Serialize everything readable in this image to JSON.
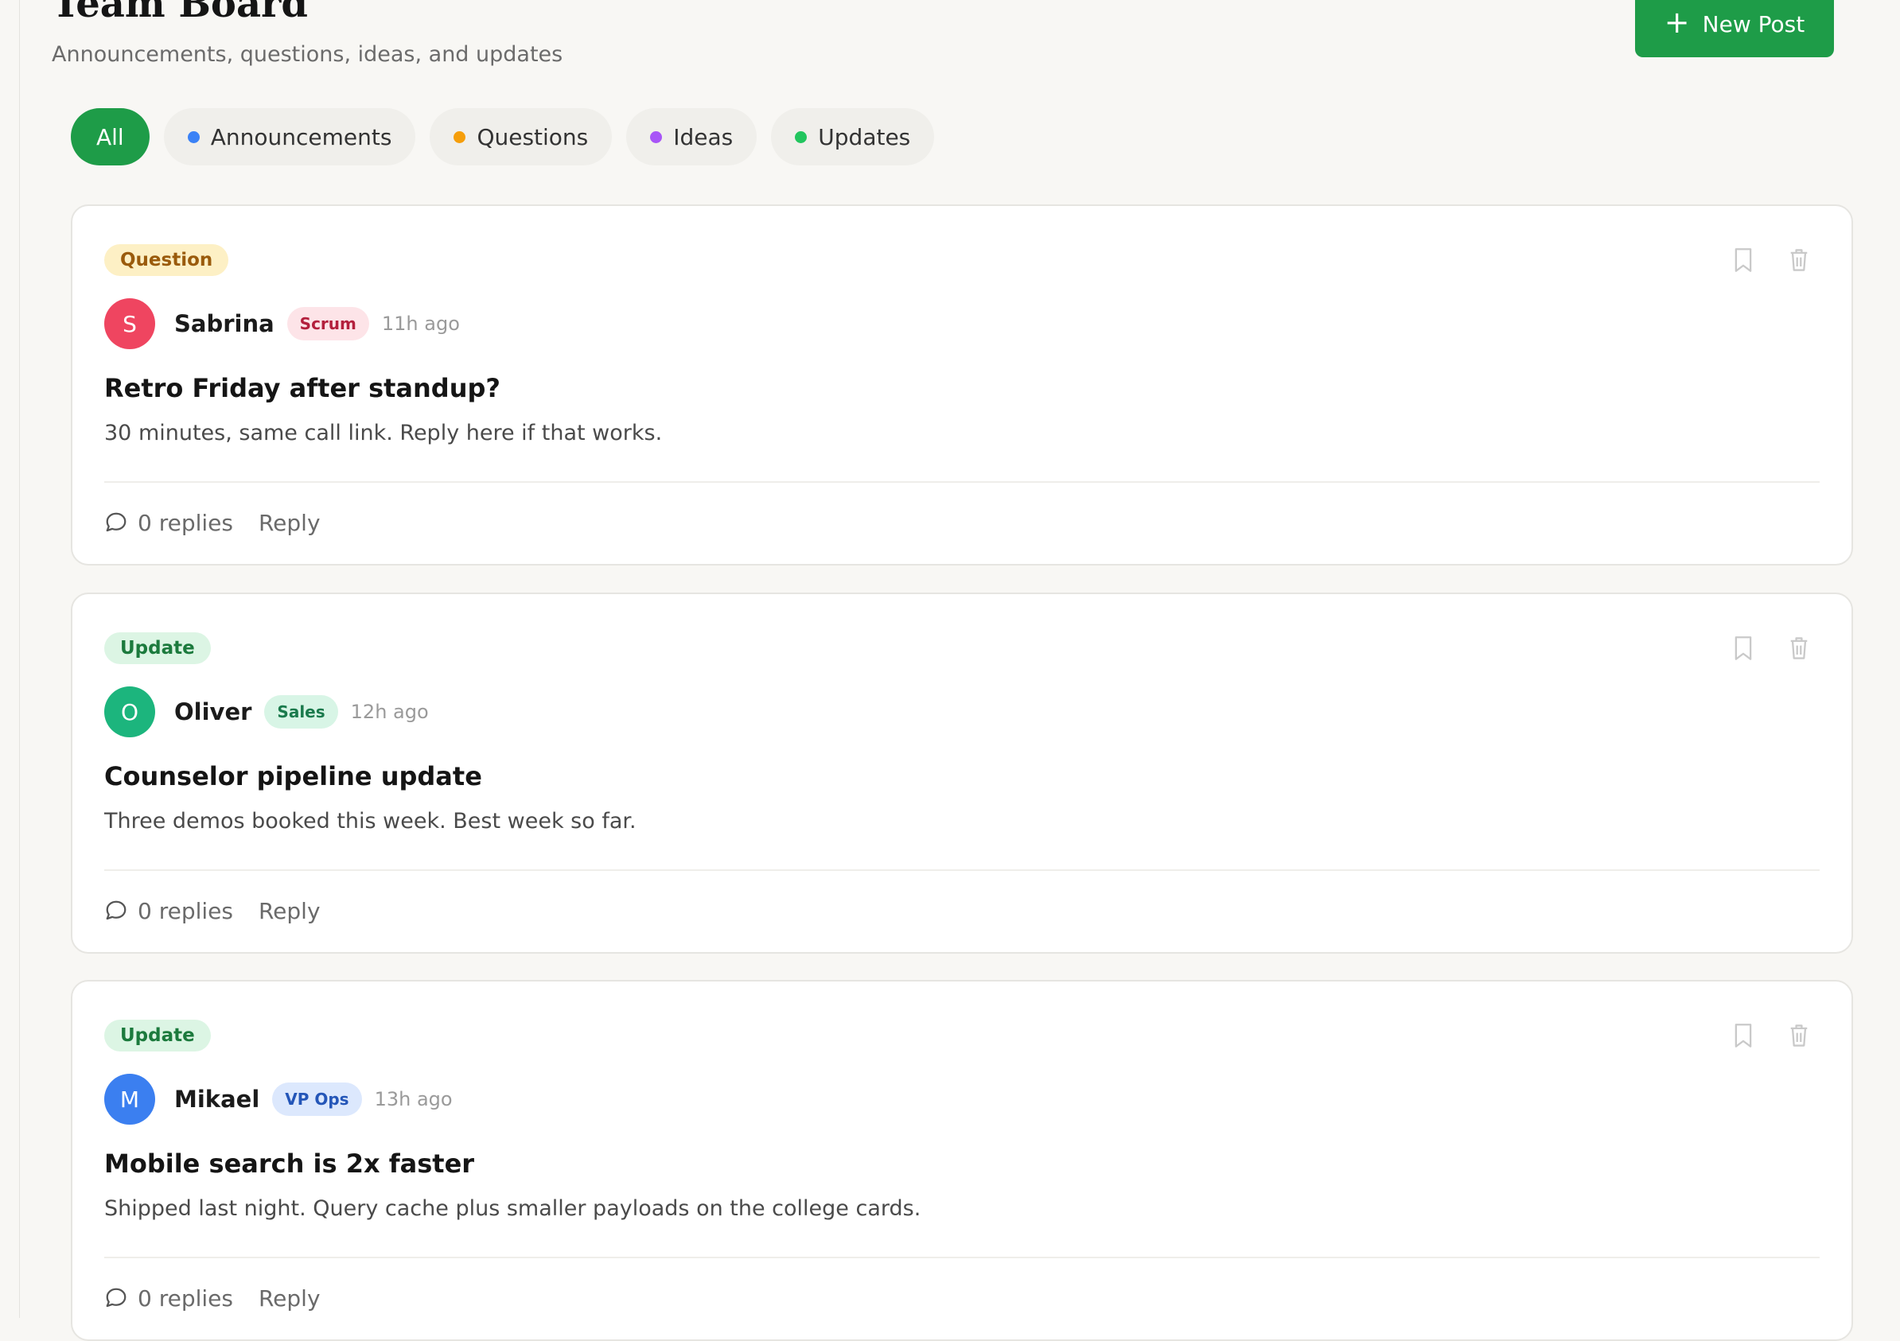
{
  "header": {
    "title": "Team Board",
    "subtitle": "Announcements, questions, ideas, and updates",
    "new_post_label": "New Post"
  },
  "filters": [
    {
      "label": "All",
      "active": true,
      "dot_color": ""
    },
    {
      "label": "Announcements",
      "active": false,
      "dot_color": "#3b82f6"
    },
    {
      "label": "Questions",
      "active": false,
      "dot_color": "#f59e0b"
    },
    {
      "label": "Ideas",
      "active": false,
      "dot_color": "#a855f7"
    },
    {
      "label": "Updates",
      "active": false,
      "dot_color": "#22c55e"
    }
  ],
  "posts": [
    {
      "tag": "Question",
      "author": "Sabrina",
      "initial": "S",
      "avatar_color": "#ef4560",
      "role": "Scrum",
      "role_bg": "#fde4e8",
      "role_color": "#b3203d",
      "time": "11h ago",
      "title": "Retro Friday after standup?",
      "body": "30 minutes, same call link. Reply here if that works.",
      "replies": "0 replies",
      "reply_label": "Reply"
    },
    {
      "tag": "Update",
      "author": "Oliver",
      "initial": "O",
      "avatar_color": "#1cb57d",
      "role": "Sales",
      "role_bg": "#d8f5e6",
      "role_color": "#1a7a4c",
      "time": "12h ago",
      "title": "Counselor pipeline update",
      "body": "Three demos booked this week. Best week so far.",
      "replies": "0 replies",
      "reply_label": "Reply"
    },
    {
      "tag": "Update",
      "author": "Mikael",
      "initial": "M",
      "avatar_color": "#3b7ff0",
      "role": "VP Ops",
      "role_bg": "#dce8fd",
      "role_color": "#2456b8",
      "time": "13h ago",
      "title": "Mobile search is 2x faster",
      "body": "Shipped last night. Query cache plus smaller payloads on the college cards.",
      "replies": "0 replies",
      "reply_label": "Reply"
    }
  ]
}
